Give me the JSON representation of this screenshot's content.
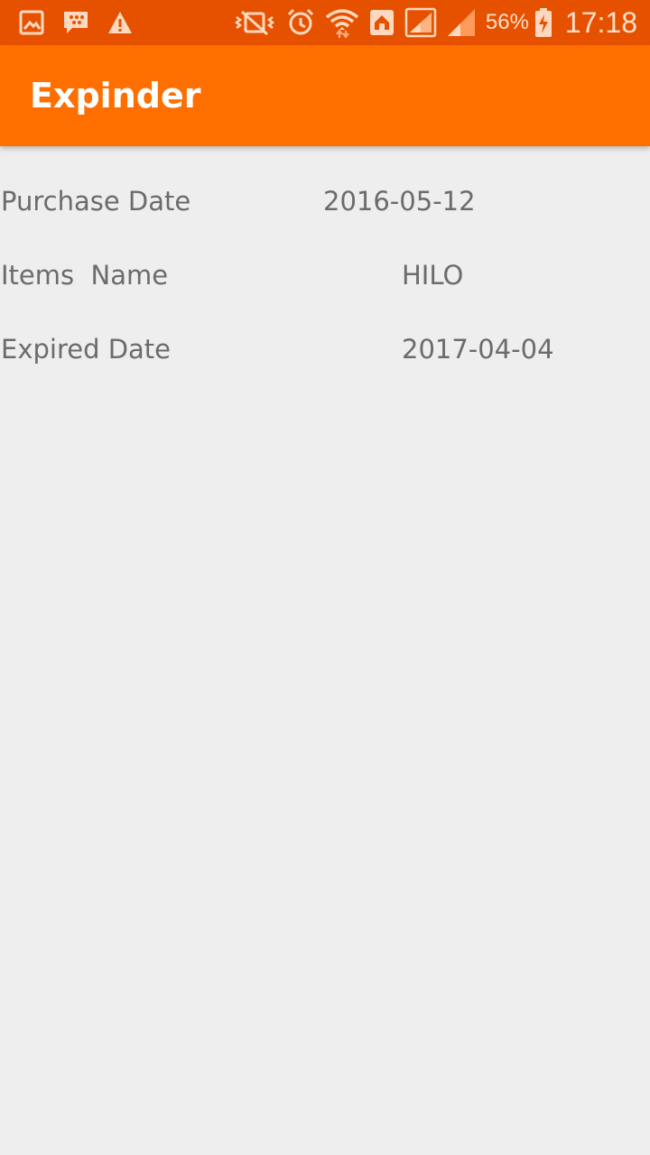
{
  "status_bar": {
    "left_icons": [
      "gallery-icon",
      "bbm-icon",
      "warning-icon"
    ],
    "right_icons": [
      "vibrate-icon",
      "alarm-icon",
      "wifi-icon",
      "home-icon",
      "signal-icon",
      "signal-icon-2",
      "battery-charging-icon"
    ],
    "battery_percent": "56%",
    "time": "17:18"
  },
  "app_bar": {
    "title": "Expinder"
  },
  "details": [
    {
      "label": "Purchase Date",
      "value": "2016-05-12"
    },
    {
      "label": "Items  Name",
      "value": "HILO"
    },
    {
      "label": "Expired Date",
      "value": "2017-04-04"
    }
  ],
  "colors": {
    "status_bar": "#e65100",
    "app_bar": "#ff6f00",
    "background": "#eeeeee",
    "text": "#6b6b6b"
  }
}
